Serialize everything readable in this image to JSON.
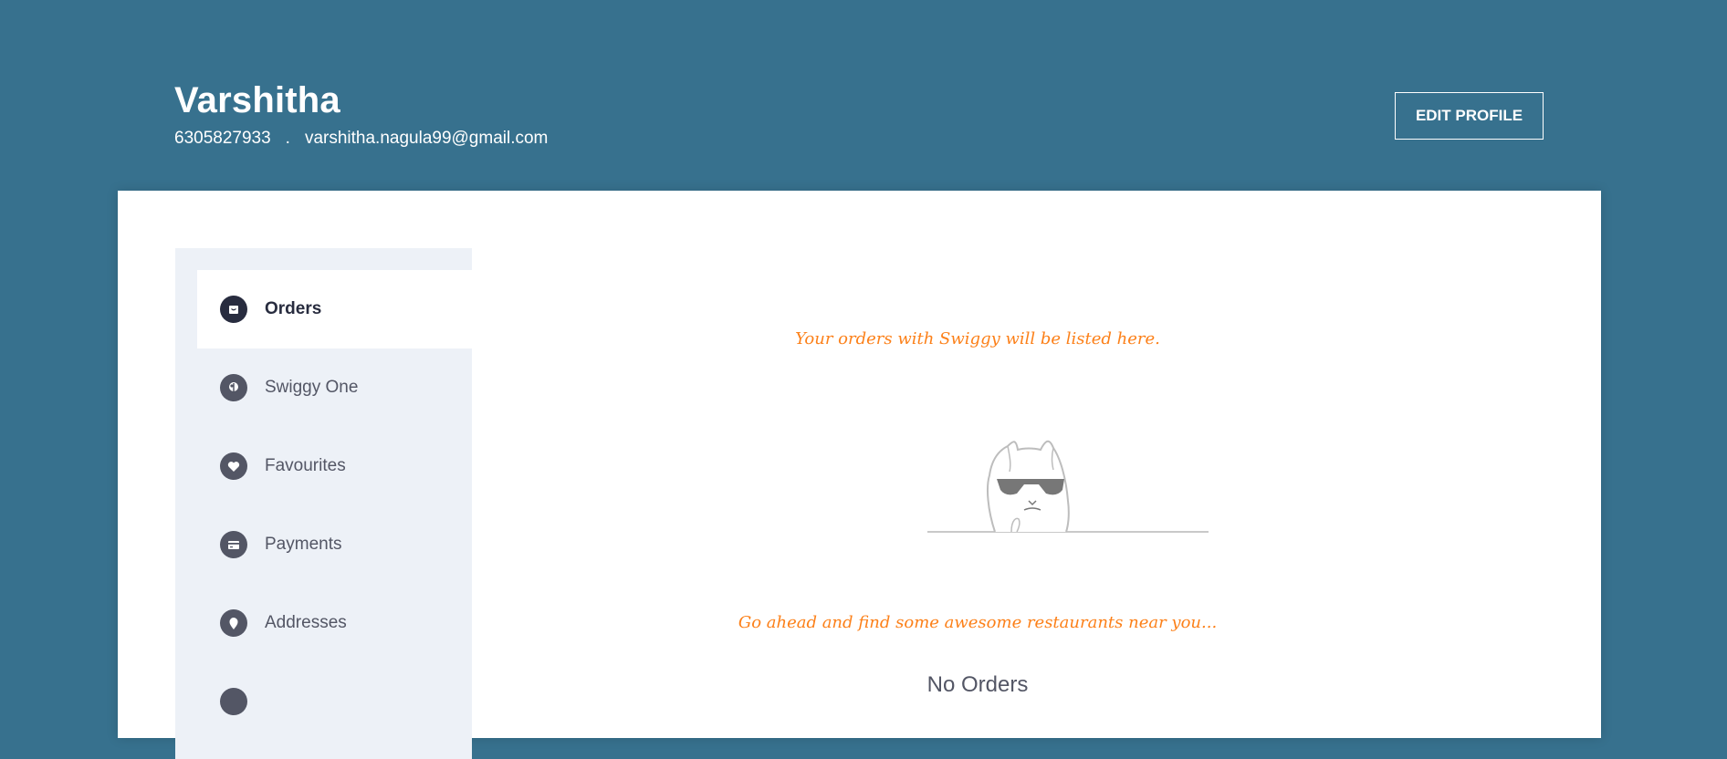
{
  "profile": {
    "name": "Varshitha",
    "phone": "6305827933",
    "separator": ".",
    "email": "varshitha.nagula99@gmail.com",
    "edit_label": "EDIT PROFILE"
  },
  "sidebar": {
    "items": [
      {
        "label": "Orders",
        "icon": "orders-icon",
        "active": true
      },
      {
        "label": "Swiggy One",
        "icon": "swiggy-one-icon",
        "active": false
      },
      {
        "label": "Favourites",
        "icon": "heart-icon",
        "active": false
      },
      {
        "label": "Payments",
        "icon": "card-icon",
        "active": false
      },
      {
        "label": "Addresses",
        "icon": "location-pin-icon",
        "active": false
      }
    ]
  },
  "orders": {
    "empty_message": "Your orders with Swiggy will be listed here.",
    "hint": "Go ahead and find some awesome restaurants near you...",
    "empty_title": "No Orders"
  },
  "colors": {
    "header_bg": "#37718e",
    "accent": "#fc8019",
    "sidebar_bg": "#edf1f7",
    "text_dark": "#282c3f",
    "text_muted": "#535665"
  }
}
